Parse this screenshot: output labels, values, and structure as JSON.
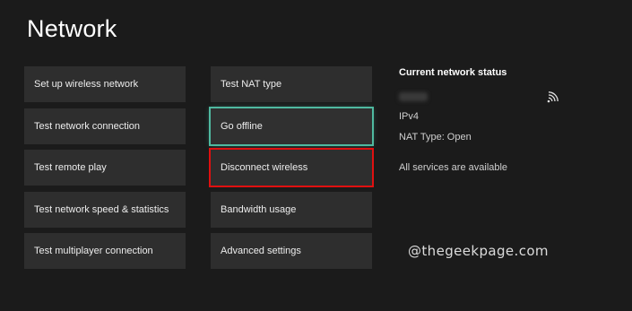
{
  "page": {
    "title": "Network"
  },
  "left_column": [
    {
      "label": "Set up wireless network"
    },
    {
      "label": "Test network connection"
    },
    {
      "label": "Test remote play"
    },
    {
      "label": "Test network speed & statistics"
    },
    {
      "label": "Test multiplayer connection"
    }
  ],
  "middle_column": [
    {
      "label": "Test NAT type"
    },
    {
      "label": "Go offline"
    },
    {
      "label": "Disconnect wireless"
    },
    {
      "label": "Bandwidth usage"
    },
    {
      "label": "Advanced settings"
    }
  ],
  "status": {
    "title": "Current network status",
    "ip_version": "IPv4",
    "nat_type": "NAT Type: Open",
    "services": "All services are available",
    "signal_icon": "wifi-signal-icon"
  },
  "watermark": "@thegeekpage.com",
  "colors": {
    "background": "#1b1b1b",
    "tile": "#2e2e2e",
    "focus_outline": "#4fb9a0",
    "highlight_outline": "#e01010"
  }
}
